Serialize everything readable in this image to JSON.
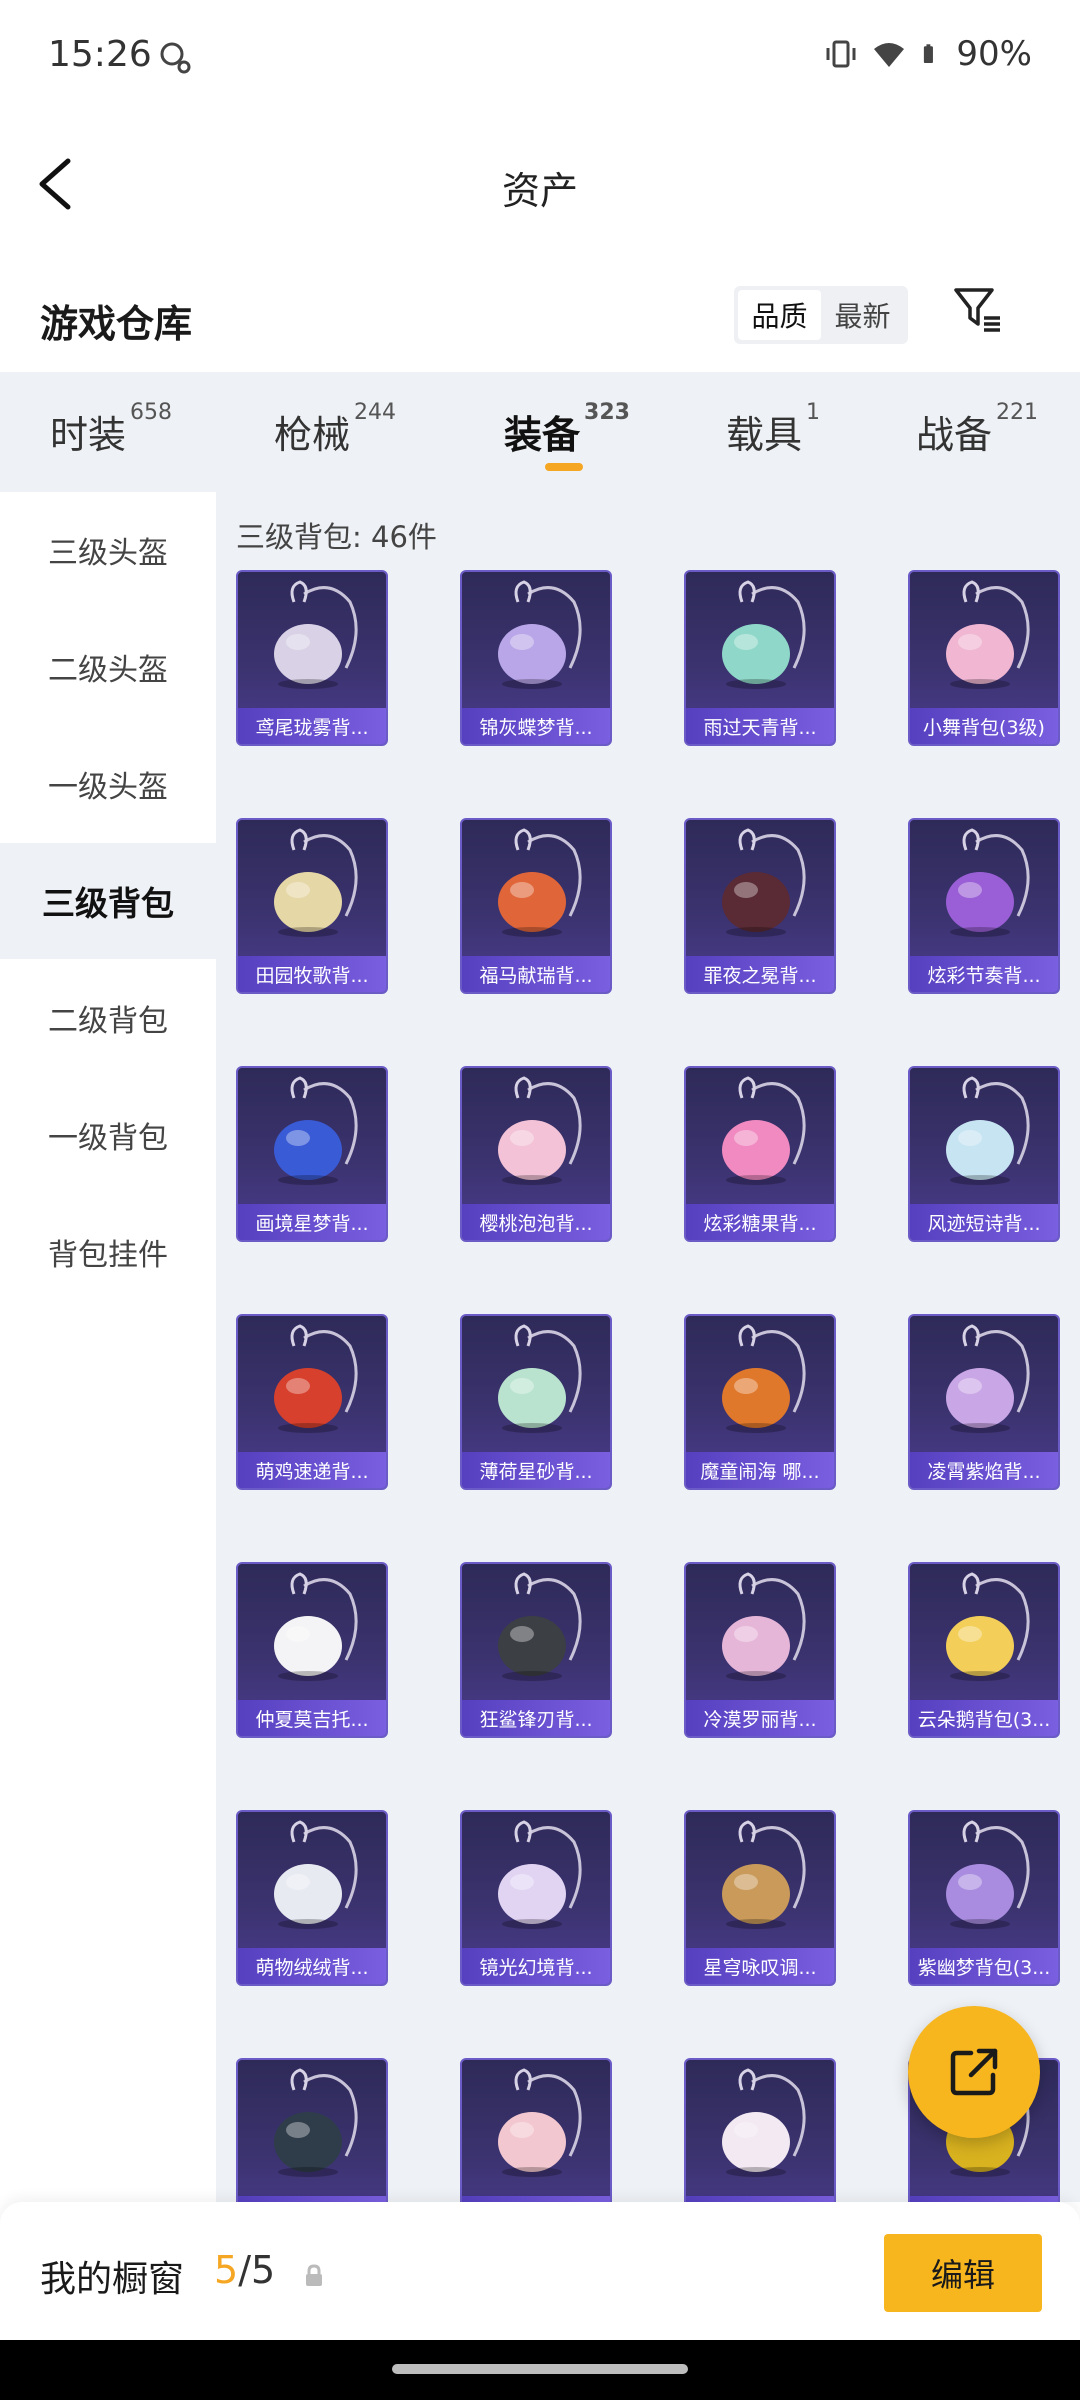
{
  "status": {
    "time": "15:26",
    "battery": "90%"
  },
  "header": {
    "title": "资产"
  },
  "warehouse": {
    "title": "游戏仓库",
    "sort": [
      "品质",
      "最新"
    ],
    "sort_active": 0
  },
  "tabs": [
    {
      "label": "时装",
      "count": "658"
    },
    {
      "label": "枪械",
      "count": "244"
    },
    {
      "label": "装备",
      "count": "323"
    },
    {
      "label": "载具",
      "count": "1"
    },
    {
      "label": "战备",
      "count": "221"
    }
  ],
  "active_tab": 2,
  "sidebar": {
    "items": [
      "三级头盔",
      "二级头盔",
      "一级头盔",
      "三级背包",
      "二级背包",
      "一级背包",
      "背包挂件"
    ],
    "active": 3
  },
  "content": {
    "title": "三级背包: 46件",
    "items": [
      {
        "name": "鸢尾珑雾背...",
        "color": "#d9d2e6"
      },
      {
        "name": "锦灰蝶梦背...",
        "color": "#b9a6e8"
      },
      {
        "name": "雨过天青背...",
        "color": "#8fd8c9"
      },
      {
        "name": "小舞背包(3级)",
        "color": "#f0b6d2"
      },
      {
        "name": "田园牧歌背...",
        "color": "#e6d7a6"
      },
      {
        "name": "福马献瑞背...",
        "color": "#e0663a"
      },
      {
        "name": "罪夜之冕背...",
        "color": "#5a2a35"
      },
      {
        "name": "炫彩节奏背...",
        "color": "#9a5fd6"
      },
      {
        "name": "画境星梦背...",
        "color": "#3a5bd6"
      },
      {
        "name": "樱桃泡泡背...",
        "color": "#f3c2d6"
      },
      {
        "name": "炫彩糖果背...",
        "color": "#f08ac0"
      },
      {
        "name": "风迹短诗背...",
        "color": "#c7e4f2"
      },
      {
        "name": "萌鸡速递背...",
        "color": "#d6402c"
      },
      {
        "name": "薄荷星砂背...",
        "color": "#b9e3cf"
      },
      {
        "name": "魔童闹海 哪...",
        "color": "#e0782c"
      },
      {
        "name": "凌霄紫焰背...",
        "color": "#c9a6e6"
      },
      {
        "name": "仲夏莫吉托...",
        "color": "#f4f4f6"
      },
      {
        "name": "狂鲨锋刃背...",
        "color": "#3c3f44"
      },
      {
        "name": "冷漠罗丽背...",
        "color": "#e6b6d8"
      },
      {
        "name": "云朵鹅背包(3...",
        "color": "#f3cf5a"
      },
      {
        "name": "萌物绒绒背...",
        "color": "#e8eaf2"
      },
      {
        "name": "镜光幻境背...",
        "color": "#e1d4f3"
      },
      {
        "name": "星穹咏叹调...",
        "color": "#c99a5a"
      },
      {
        "name": "紫幽梦背包(3...",
        "color": "#a98ce0"
      },
      {
        "name": "",
        "color": "#2f3d4a"
      },
      {
        "name": "",
        "color": "#f3c7cf"
      },
      {
        "name": "",
        "color": "#f2e9f2"
      },
      {
        "name": "",
        "color": "#d9b21f"
      }
    ]
  },
  "bottom": {
    "label": "我的橱窗",
    "count_current": "5",
    "count_total": "/5",
    "edit": "编辑"
  }
}
